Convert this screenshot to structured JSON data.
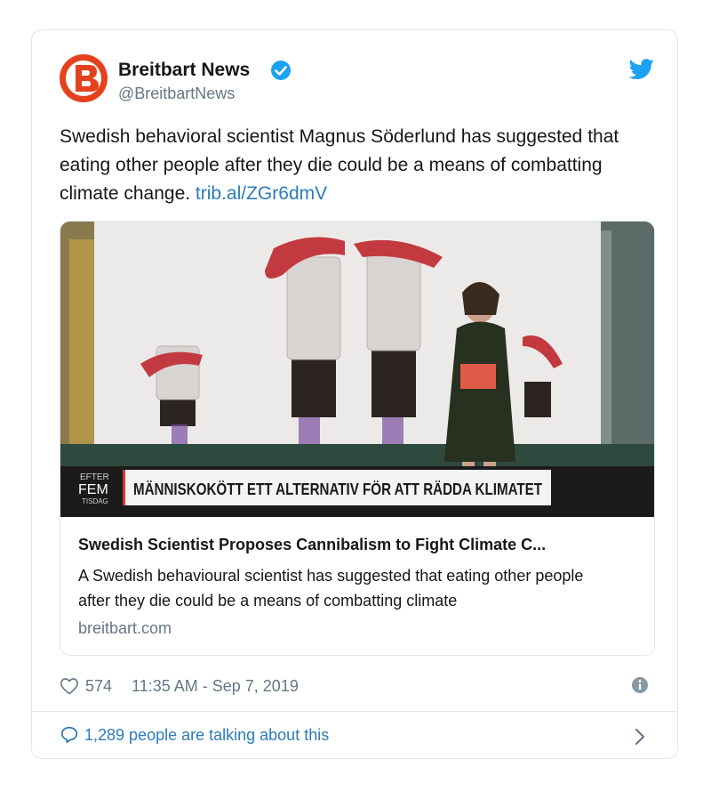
{
  "tweet": {
    "author_name": "Breitbart News",
    "handle": "@BreitbartNews",
    "text_main": "Swedish behavioral scientist Magnus Söderlund has suggested that eating other people after they die could be a means of combatting climate change. ",
    "text_link": "trib.al/ZGr6dmV",
    "likes": "574",
    "timestamp": "11:35 AM - Sep 7, 2019",
    "talking": "1,289 people are talking about this"
  },
  "card": {
    "banner_top": "EFTER",
    "banner_mid": "FEM",
    "banner_bottom": "TISDAG",
    "banner_headline": "MÄNNISKOKÖTT ETT ALTERNATIV FÖR ATT RÄDDA KLIMATET",
    "title": "Swedish Scientist Proposes Cannibalism to Fight Climate C...",
    "description": "A Swedish behavioural scientist has suggested that eating other people after they die could be a means of combatting climate",
    "domain": "breitbart.com"
  },
  "icons": {
    "avatar": "breitbart-logo-icon",
    "verified": "verified-badge-icon",
    "twitter": "twitter-bird-icon",
    "like": "heart-icon",
    "info": "info-icon",
    "reply": "speech-bubble-icon",
    "chevron": "chevron-right-icon"
  },
  "colors": {
    "link": "#2b7bb9",
    "twitter_blue": "#1da1f2",
    "brand_orange": "#e4421f",
    "secondary_text": "#657786",
    "border": "#e1e8ed"
  }
}
